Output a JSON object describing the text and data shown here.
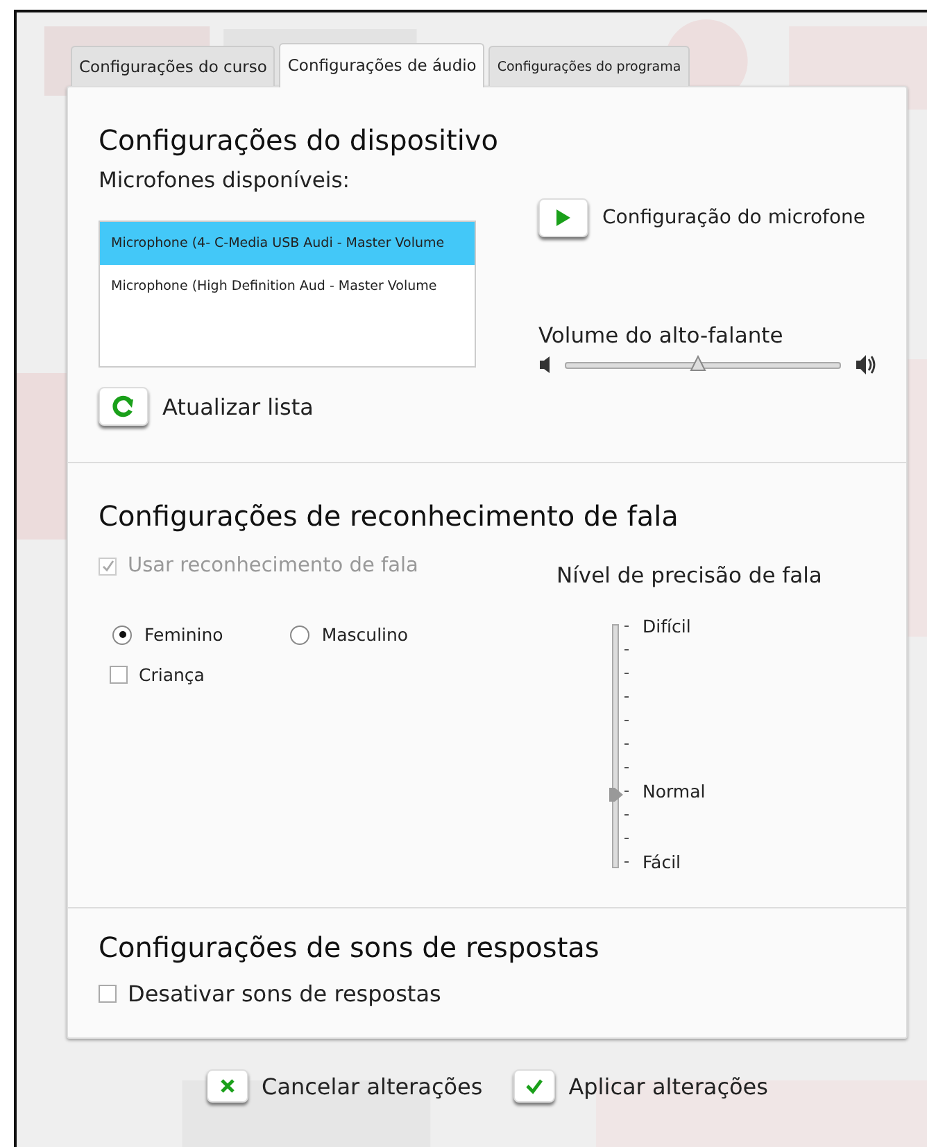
{
  "tabs": [
    {
      "label": "Configurações do curso",
      "selected": false
    },
    {
      "label": "Configurações de áudio",
      "selected": true
    },
    {
      "label": "Configurações do programa",
      "selected": false
    }
  ],
  "device": {
    "title": "Configurações do dispositivo",
    "list_label": "Microfones disponíveis:",
    "microphones": [
      {
        "label": "Microphone (4- C-Media USB Audi - Master Volume",
        "selected": true
      },
      {
        "label": "Microphone (High Definition Aud - Master Volume",
        "selected": false
      }
    ],
    "mic_setup_button": "Configuração do microfone",
    "refresh_button": "Atualizar lista",
    "speaker_volume": {
      "label": "Volume do alto-falante",
      "level": 0.48
    }
  },
  "speech": {
    "title": "Configurações de reconhecimento de fala",
    "use_recognition": {
      "label": "Usar reconhecimento de fala",
      "checked": true,
      "disabled": true
    },
    "voices": [
      {
        "label": "Feminino",
        "selected": true
      },
      {
        "label": "Masculino",
        "selected": false
      }
    ],
    "child": {
      "label": "Criança",
      "checked": false
    },
    "accuracy": {
      "label": "Nível de precisão de fala",
      "level": 0.3,
      "scale_labels": [
        "Difícil",
        "Normal",
        "Fácil"
      ]
    }
  },
  "feedback": {
    "title": "Configurações de sons de respostas",
    "disable_sounds": {
      "label": "Desativar sons de respostas",
      "checked": false
    }
  },
  "buttons": [
    {
      "kind": "cancel",
      "label": "Cancelar alterações"
    },
    {
      "kind": "apply",
      "label": "Aplicar alterações"
    }
  ]
}
